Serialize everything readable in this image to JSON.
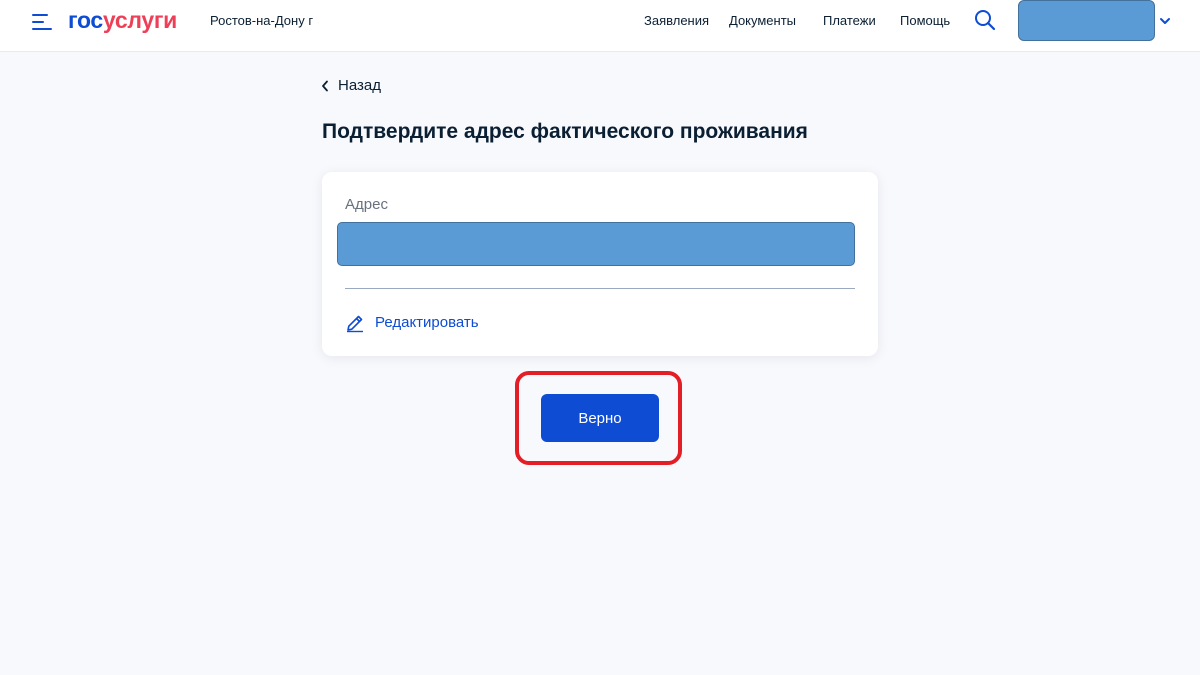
{
  "header": {
    "logo": {
      "part1": "гос",
      "part2": "услуги"
    },
    "city": "Ростов-на-Дону г",
    "nav": [
      "Заявления",
      "Документы",
      "Платежи",
      "Помощь"
    ],
    "icons": {
      "menu": "menu-icon",
      "search": "search-icon",
      "chevron": "chevron-down-icon"
    }
  },
  "page": {
    "back_label": "Назад",
    "title": "Подтвердите адрес фактического проживания"
  },
  "card": {
    "field_label": "Адрес",
    "address_value": "",
    "edit_label": "Редактировать"
  },
  "actions": {
    "confirm_label": "Верно"
  },
  "colors": {
    "brand_blue": "#0d4cd3",
    "brand_red": "#ee3f58",
    "highlight": "#e41e26",
    "redaction": "#5b9bd5"
  }
}
